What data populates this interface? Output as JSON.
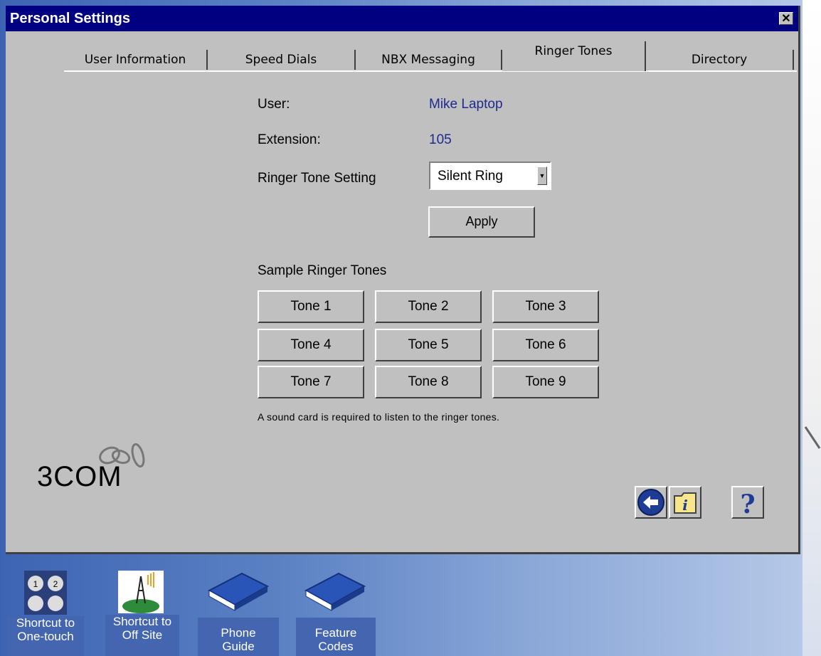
{
  "window": {
    "title": "Personal Settings",
    "close_label": "✕"
  },
  "tabs": [
    {
      "label": "User Information"
    },
    {
      "label": "Speed Dials"
    },
    {
      "label": "NBX Messaging"
    },
    {
      "label": "Ringer Tones"
    },
    {
      "label": "Directory"
    }
  ],
  "form": {
    "user_label": "User:",
    "user_value": "Mike Laptop",
    "extension_label": "Extension:",
    "extension_value": "105",
    "ringer_label": "Ringer Tone Setting",
    "ringer_selected": "Silent Ring",
    "apply_label": "Apply"
  },
  "samples": {
    "heading": "Sample Ringer Tones",
    "tones": [
      "Tone 1",
      "Tone 2",
      "Tone 3",
      "Tone 4",
      "Tone 5",
      "Tone 6",
      "Tone 7",
      "Tone 8",
      "Tone 9"
    ],
    "note": "A sound card is required to listen to the ringer tones."
  },
  "logo": {
    "text": "3COM"
  },
  "nav": {
    "icons": [
      "back-arrow-icon",
      "info-folder-icon",
      "help-icon"
    ]
  },
  "desktop_icons": [
    {
      "label_line1": "Shortcut to",
      "label_line2": "One-touch",
      "icon": "keypad-icon"
    },
    {
      "label_line1": "Shortcut to",
      "label_line2": "Off Site",
      "icon": "antenna-globe-icon"
    },
    {
      "label_line1": "Phone",
      "label_line2": "Guide",
      "icon": "book-icon"
    },
    {
      "label_line1": "Feature",
      "label_line2": "Codes",
      "icon": "book-icon"
    }
  ],
  "colors": {
    "title_bar": "#000080",
    "value_text": "#1f2a8c",
    "window_face": "#c0c0c0"
  }
}
